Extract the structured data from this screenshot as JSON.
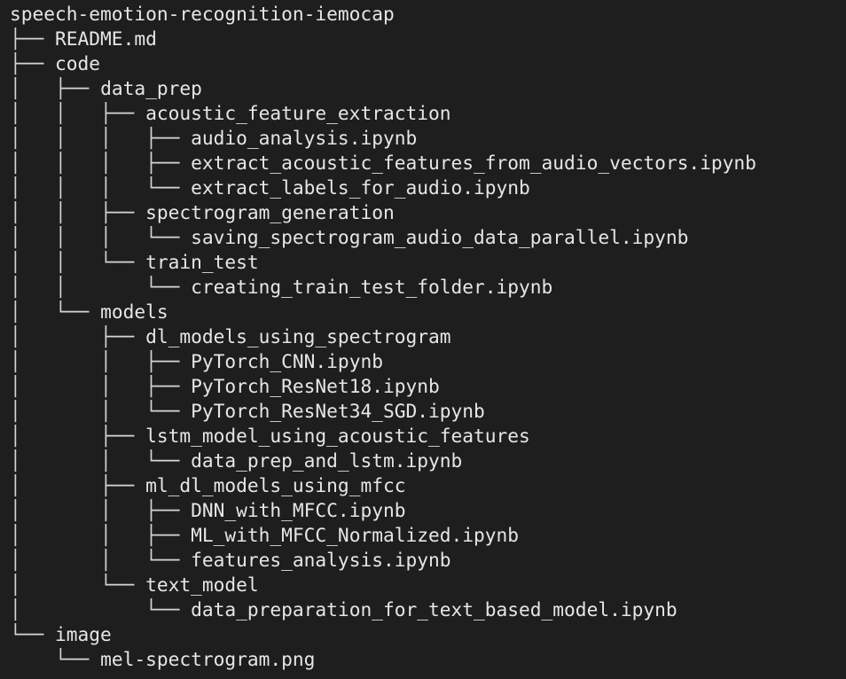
{
  "tree": {
    "root": "speech-emotion-recognition-iemocap",
    "lines": [
      {
        "prefix": "├── ",
        "name": "README.md"
      },
      {
        "prefix": "├── ",
        "name": "code"
      },
      {
        "prefix": "│   ├── ",
        "name": "data_prep"
      },
      {
        "prefix": "│   │   ├── ",
        "name": "acoustic_feature_extraction"
      },
      {
        "prefix": "│   │   │   ├── ",
        "name": "audio_analysis.ipynb"
      },
      {
        "prefix": "│   │   │   ├── ",
        "name": "extract_acoustic_features_from_audio_vectors.ipynb"
      },
      {
        "prefix": "│   │   │   └── ",
        "name": "extract_labels_for_audio.ipynb"
      },
      {
        "prefix": "│   │   ├── ",
        "name": "spectrogram_generation"
      },
      {
        "prefix": "│   │   │   └── ",
        "name": "saving_spectrogram_audio_data_parallel.ipynb"
      },
      {
        "prefix": "│   │   └── ",
        "name": "train_test"
      },
      {
        "prefix": "│   │       └── ",
        "name": "creating_train_test_folder.ipynb"
      },
      {
        "prefix": "│   └── ",
        "name": "models"
      },
      {
        "prefix": "│       ├── ",
        "name": "dl_models_using_spectrogram"
      },
      {
        "prefix": "│       │   ├── ",
        "name": "PyTorch_CNN.ipynb"
      },
      {
        "prefix": "│       │   ├── ",
        "name": "PyTorch_ResNet18.ipynb"
      },
      {
        "prefix": "│       │   └── ",
        "name": "PyTorch_ResNet34_SGD.ipynb"
      },
      {
        "prefix": "│       ├── ",
        "name": "lstm_model_using_acoustic_features"
      },
      {
        "prefix": "│       │   └── ",
        "name": "data_prep_and_lstm.ipynb"
      },
      {
        "prefix": "│       ├── ",
        "name": "ml_dl_models_using_mfcc"
      },
      {
        "prefix": "│       │   ├── ",
        "name": "DNN_with_MFCC.ipynb"
      },
      {
        "prefix": "│       │   ├── ",
        "name": "ML_with_MFCC_Normalized.ipynb"
      },
      {
        "prefix": "│       │   └── ",
        "name": "features_analysis.ipynb"
      },
      {
        "prefix": "│       └── ",
        "name": "text_model"
      },
      {
        "prefix": "│           └── ",
        "name": "data_preparation_for_text_based_model.ipynb"
      },
      {
        "prefix": "└── ",
        "name": "image"
      },
      {
        "prefix": "    └── ",
        "name": "mel-spectrogram.png"
      }
    ]
  }
}
